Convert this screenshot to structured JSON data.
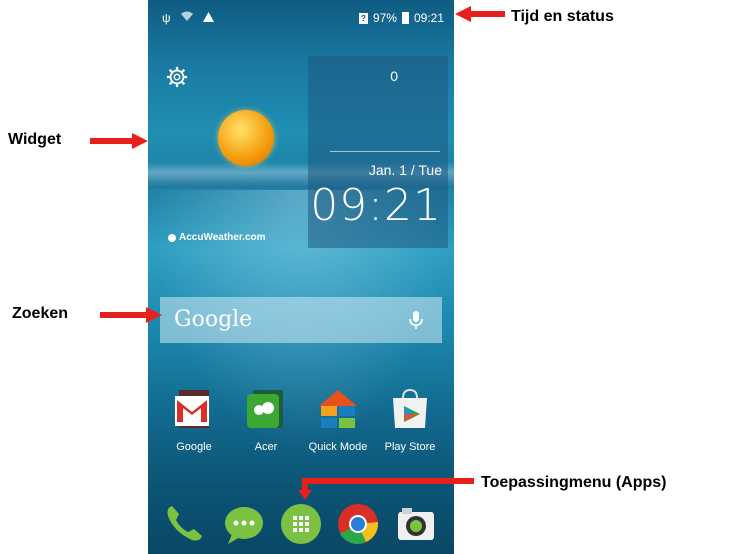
{
  "status_bar": {
    "battery": "97%",
    "time": "09:21"
  },
  "widget": {
    "count": "0",
    "date": "Jan. 1 / Tue",
    "time": "09:21",
    "provider": "AccuWeather.com"
  },
  "search": {
    "label": "Google"
  },
  "apps": [
    {
      "label": "Google",
      "icon": "gmail-folder-icon"
    },
    {
      "label": "Acer",
      "icon": "acer-folder-icon"
    },
    {
      "label": "Quick Mode",
      "icon": "quick-mode-icon"
    },
    {
      "label": "Play Store",
      "icon": "play-store-icon"
    }
  ],
  "dock": [
    {
      "icon": "phone-icon"
    },
    {
      "icon": "messaging-icon"
    },
    {
      "icon": "apps-menu-icon"
    },
    {
      "icon": "chrome-icon"
    },
    {
      "icon": "camera-icon"
    }
  ],
  "annotations": {
    "status": "Tijd en status",
    "widget": "Widget",
    "search": "Zoeken",
    "apps": "Toepassingmenu (Apps)"
  },
  "colors": {
    "arrow": "#e8201c",
    "apps_button": "#7cc242"
  }
}
